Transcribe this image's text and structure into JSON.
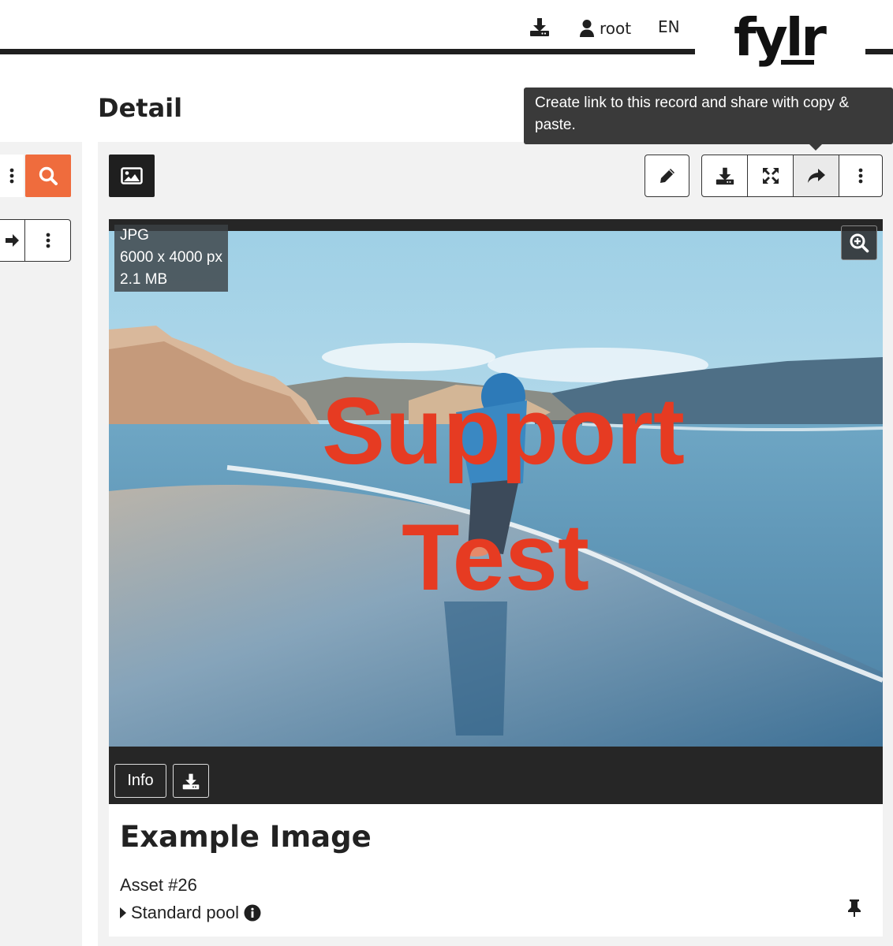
{
  "header": {
    "user_label": "root",
    "language": "EN",
    "logo_text": "fylr",
    "download_icon": "download-icon",
    "user_icon": "user-icon"
  },
  "left_panel": {
    "search_icon": "search-icon",
    "search_color": "#ef6c3d"
  },
  "detail": {
    "title": "Detail",
    "tooltip": "Create link to this record and share with copy & paste.",
    "toolbar": {
      "edit_icon": "pencil-icon",
      "download_icon": "download-icon",
      "fullscreen_icon": "expand-icon",
      "share_icon": "share-icon",
      "more_icon": "kebab-icon"
    }
  },
  "viewer": {
    "file_type": "JPG",
    "dimensions": "6000 x 4000 px",
    "file_size": "2.1 MB",
    "watermark_line1": "Support",
    "watermark_line2": "Test",
    "info_label": "Info"
  },
  "record": {
    "title": "Example Image",
    "asset_id": "Asset #26",
    "pool": "Standard pool"
  },
  "colors": {
    "accent": "#ef6c3d",
    "dark": "#1f1f1f",
    "panel": "#f2f2f2",
    "watermark": "#e63b22"
  }
}
